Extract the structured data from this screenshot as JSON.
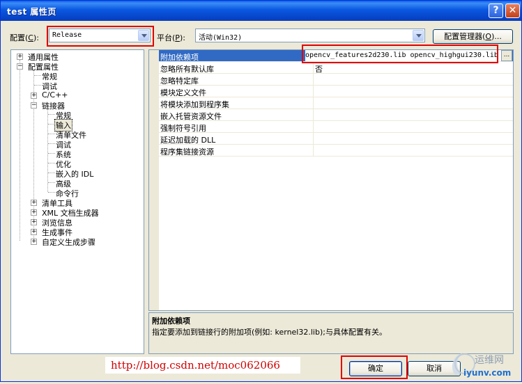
{
  "window": {
    "title": "test 属性页"
  },
  "titlebar": {
    "help_glyph": "?",
    "close_glyph": "✕"
  },
  "config": {
    "label": "配置(",
    "mnemonic": "C",
    "label_end": "):",
    "value": "Release"
  },
  "platform": {
    "label": "平台(",
    "mnemonic": "P",
    "label_end": "):",
    "value": "活动(Win32)"
  },
  "config_manager": {
    "label": "配置管理器(",
    "mnemonic": "O",
    "label_end": ")..."
  },
  "tree": {
    "common": "通用属性",
    "config_props": "配置属性",
    "general": "常规",
    "debugging": "调试",
    "cpp": "C/C++",
    "linker": "链接器",
    "linker_general": "常规",
    "linker_input": "输入",
    "manifest_file": "清单文件",
    "linker_debug": "调试",
    "system": "系统",
    "optimization": "优化",
    "embedded_idl": "嵌入的 IDL",
    "advanced": "高级",
    "command_line": "命令行",
    "manifest_tool": "清单工具",
    "xml_doc": "XML 文档生成器",
    "browse_info": "浏览信息",
    "build_events": "生成事件",
    "custom_build": "自定义生成步骤"
  },
  "grid": {
    "rows": [
      {
        "name": "附加依赖项",
        "value": "opencv_features2d230.lib opencv_highgui230.lib"
      },
      {
        "name": "忽略所有默认库",
        "value": "否"
      },
      {
        "name": "忽略特定库",
        "value": ""
      },
      {
        "name": "模块定义文件",
        "value": ""
      },
      {
        "name": "将模块添加到程序集",
        "value": ""
      },
      {
        "name": "嵌入托管资源文件",
        "value": ""
      },
      {
        "name": "强制符号引用",
        "value": ""
      },
      {
        "name": "延迟加载的 DLL",
        "value": ""
      },
      {
        "name": "程序集链接资源",
        "value": ""
      }
    ],
    "ellipsis": "..."
  },
  "description": {
    "title": "附加依赖项",
    "text": "指定要添加到链接行的附加项(例如: kernel32.lib);与具体配置有关。"
  },
  "buttons": {
    "ok": "确定",
    "cancel": "取消"
  },
  "watermark": {
    "url": "http://blog.csdn.net/moc062066"
  },
  "logo": {
    "cn": "运维网",
    "domain": "iyunv.com"
  },
  "colors": {
    "selection": "#316ac5",
    "highlight_box": "#e00000",
    "titlebar": "#0a58e0"
  }
}
